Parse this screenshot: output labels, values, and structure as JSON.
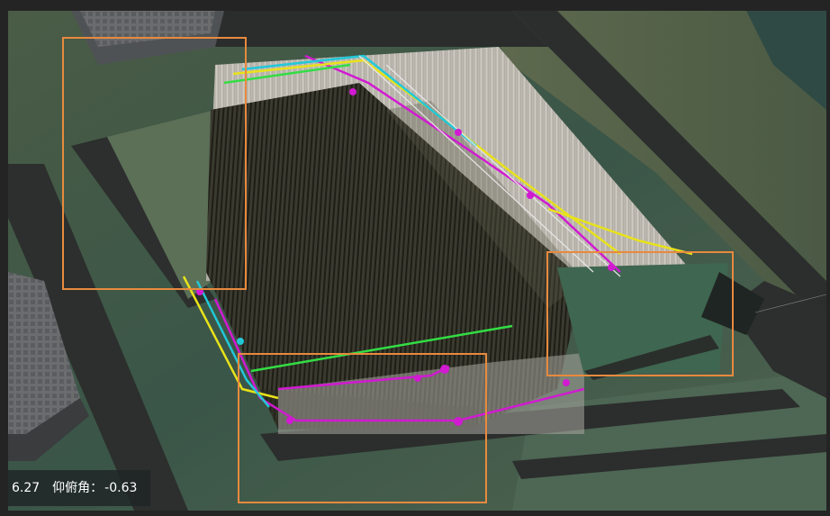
{
  "status_bar": {
    "heading_value": "6.27",
    "pitch_label": "仰俯角：",
    "pitch_value": "-0.63"
  },
  "colors": {
    "selection_box": "#e88a3e",
    "pipe_magenta": "#d11ad1",
    "pipe_yellow": "#e8e21a",
    "pipe_cyan": "#22c8d8",
    "pipe_green": "#33dd44",
    "pile": "#2b2b21",
    "pit_wall": "#c9c5bd",
    "road": "#2c2f2d",
    "terrain": "#3d5a48"
  },
  "selection_boxes": [
    {
      "name": "selection-box-top-left"
    },
    {
      "name": "selection-box-bottom-center"
    },
    {
      "name": "selection-box-right"
    }
  ]
}
